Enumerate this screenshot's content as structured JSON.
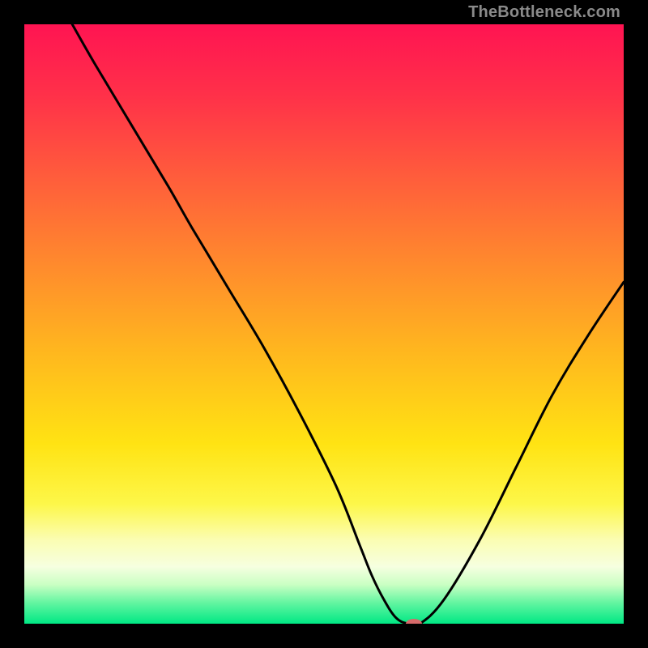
{
  "watermark": "TheBottleneck.com",
  "chart_data": {
    "type": "line",
    "title": "",
    "xlabel": "",
    "ylabel": "",
    "xlim": [
      0,
      100
    ],
    "ylim": [
      0,
      100
    ],
    "grid": false,
    "gradient_stops": [
      {
        "offset": 0.0,
        "color": "#ff1452"
      },
      {
        "offset": 0.12,
        "color": "#ff3149"
      },
      {
        "offset": 0.25,
        "color": "#ff5b3c"
      },
      {
        "offset": 0.4,
        "color": "#ff8a2d"
      },
      {
        "offset": 0.55,
        "color": "#ffb81e"
      },
      {
        "offset": 0.7,
        "color": "#ffe313"
      },
      {
        "offset": 0.8,
        "color": "#fdf749"
      },
      {
        "offset": 0.86,
        "color": "#fbfdb2"
      },
      {
        "offset": 0.905,
        "color": "#f6ffe0"
      },
      {
        "offset": 0.935,
        "color": "#c9ffc3"
      },
      {
        "offset": 0.965,
        "color": "#63f5a1"
      },
      {
        "offset": 1.0,
        "color": "#00e884"
      }
    ],
    "series": [
      {
        "name": "bottleneck-curve",
        "x": [
          8,
          12,
          18,
          24,
          28,
          34,
          40,
          46,
          52,
          56,
          58,
          60,
          62,
          64,
          66,
          70,
          76,
          82,
          88,
          94,
          100
        ],
        "y": [
          100,
          93,
          83,
          73,
          66,
          56,
          46,
          35,
          23,
          13,
          8,
          4,
          1,
          0,
          0,
          4,
          14,
          26,
          38,
          48,
          57
        ]
      }
    ],
    "marker": {
      "x": 65,
      "y": 0,
      "color": "#d66a6a",
      "rx": 10,
      "ry": 6
    }
  }
}
